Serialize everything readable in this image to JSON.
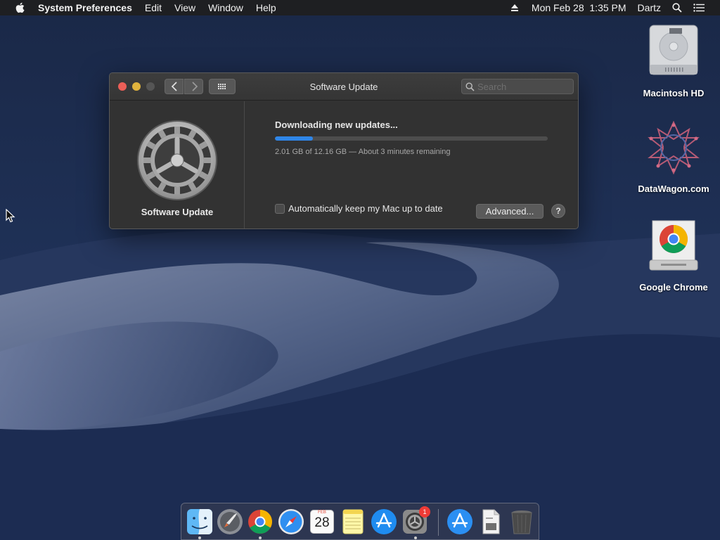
{
  "menubar": {
    "app_name": "System Preferences",
    "menus": [
      "Edit",
      "View",
      "Window",
      "Help"
    ],
    "datetime": "Mon Feb 28  1:35 PM",
    "user": "Dartz"
  },
  "desktop_icons": [
    {
      "label": "Macintosh HD",
      "icon": "hard-drive-icon"
    },
    {
      "label": "DataWagon.com",
      "icon": "datawagon-logo-icon"
    },
    {
      "label": "Google Chrome",
      "icon": "chrome-installer-icon"
    }
  ],
  "window": {
    "title": "Software Update",
    "search_placeholder": "Search",
    "sidebar_label": "Software Update",
    "status_title": "Downloading new updates...",
    "progress_fraction": 0.14,
    "status_detail": "2.01 GB of 12.16 GB — About 3 minutes remaining",
    "auto_update_label": "Automatically keep my Mac up to date",
    "auto_update_checked": false,
    "advanced_label": "Advanced...",
    "help_label": "?"
  },
  "dock": {
    "calendar_month": "FEB",
    "calendar_day": "28",
    "system_prefs_badge": "1",
    "items": [
      "finder-icon",
      "launchpad-icon",
      "chrome-icon",
      "safari-icon",
      "calendar-icon",
      "notes-icon",
      "app-store-icon",
      "system-preferences-icon",
      "app-store-folder-icon",
      "document-icon",
      "trash-icon"
    ]
  },
  "colors": {
    "accent_progress": "#2f86e8",
    "close": "#ec5f57",
    "minimize": "#e0b33d",
    "badge": "#ef3b36"
  }
}
